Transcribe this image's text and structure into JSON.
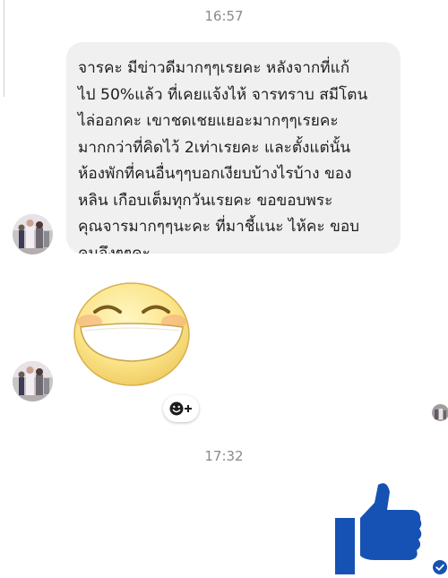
{
  "messages": [
    {
      "type": "timestamp",
      "text": "16:57"
    },
    {
      "type": "text",
      "sender": "contact",
      "text": "จารคะ มีข่าวดีมากๆๆเรยคะ หลังจากที่แก้\nไป 50%แล้ว ที่เคยแจ้งไห้ จารทราบ สมีโตน\nไล่ออกคะ เขาชดเชยแยอะมากๆๆเรยคะ\nมากกว่าที่คิดไว้ 2เท่าเรยคะ และตั้งแต่นั้น\nห้องพักที่คนอื่นๆๆบอกเงียบบ้างไรบ้าง ของ\nหลิน เกือบเต็มทุกวันเรยคะ ขอขอบพระ\nคุณจารมากๆๆนะคะ ที่มาชี้แนะ ไห้คะ ขอบ\nคุนจึงๆๆคะ"
    },
    {
      "type": "sticker",
      "sender": "contact",
      "icon": "grinning-face-sticker"
    },
    {
      "type": "timestamp",
      "text": "17:32"
    },
    {
      "type": "like",
      "sender": "me",
      "icon": "thumbs-up-icon",
      "color": "#1652b3"
    }
  ],
  "colors": {
    "bubble_bg": "#f0f0f0",
    "timestamp": "#8a8a8a",
    "like": "#1652b3",
    "sticker_face": "#fbe58a"
  },
  "reaction_button": {
    "icon": "add-reaction-icon"
  },
  "status": {
    "icon": "seen-check-icon"
  }
}
